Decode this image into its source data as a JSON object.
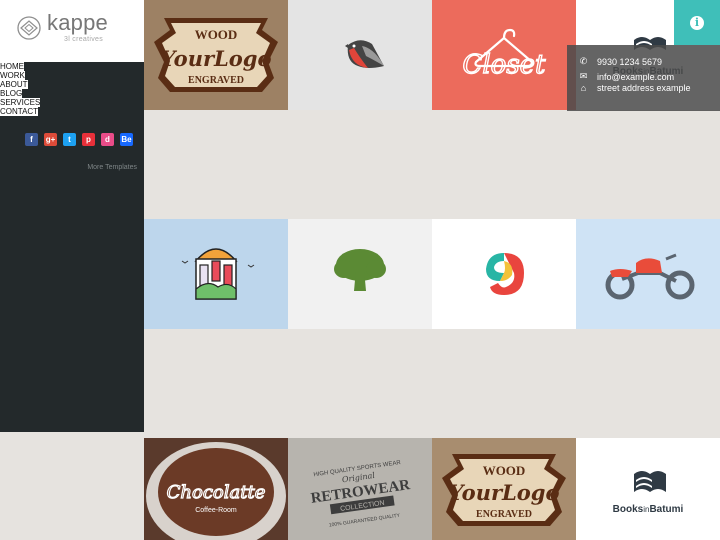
{
  "brand": {
    "name": "kappe",
    "tagline": "3l creatives"
  },
  "nav": {
    "items": [
      "HOME",
      "WORK",
      "ABOUT",
      "BLOG",
      "SERVICES",
      "CONTACT"
    ]
  },
  "social": [
    {
      "icon": "facebook-icon",
      "glyph": "f",
      "color": "#3b5998"
    },
    {
      "icon": "google-plus-icon",
      "glyph": "g+",
      "color": "#dd4b39"
    },
    {
      "icon": "twitter-icon",
      "glyph": "t",
      "color": "#1da1f2"
    },
    {
      "icon": "pinterest-icon",
      "glyph": "p",
      "color": "#e8303a"
    },
    {
      "icon": "dribbble-icon",
      "glyph": "d",
      "color": "#ea4c89"
    },
    {
      "icon": "behance-icon",
      "glyph": "Be",
      "color": "#1769ff"
    }
  ],
  "more_templates": "More Templates",
  "contact": {
    "phone": "9930 1234 5679",
    "email": "info@example.com",
    "address": "street address example"
  },
  "tiles": {
    "wood": {
      "top": "WOOD",
      "middle": "YourLogo",
      "bottom": "ENGRAVED"
    },
    "closet": {
      "text": "Closet"
    },
    "books": {
      "name_a": "Books",
      "name_b": "in",
      "name_c": "Batumi"
    },
    "chocolate": {
      "title": "Chocolatte",
      "subtitle": "Coffee-Room"
    },
    "retro": {
      "top": "HIGH QUALITY SPORTS WEAR",
      "script": "Original",
      "main": "RETROWEAR",
      "ribbon": "COLLECTION",
      "bottom": "100% GUARANTEED QUALITY"
    }
  },
  "colors": {
    "teal": "#3fbfb9",
    "sidebar": "#23292b",
    "coral": "#ec6b5c",
    "light_blue": "#bdd6ec"
  }
}
